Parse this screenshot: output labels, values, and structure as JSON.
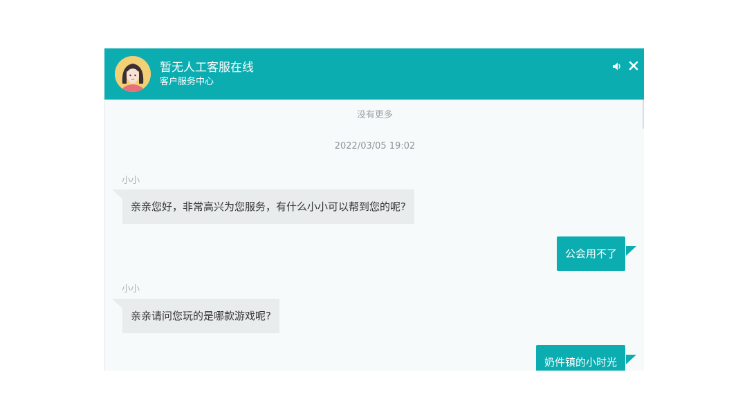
{
  "header": {
    "title": "暂无人工客服在线",
    "subtitle": "客户服务中心",
    "background_color": "#0cadb1",
    "avatar_icon": "girl-avatar-icon",
    "sound_icon": "speaker-icon",
    "close_icon": "close-icon"
  },
  "chat": {
    "load_more_label": "没有更多",
    "timestamp": "2022/03/05 19:02",
    "messages": [
      {
        "direction": "incoming",
        "sender": "小小",
        "text": "亲亲您好，非常高兴为您服务，有什么小小可以帮到您的呢?"
      },
      {
        "direction": "outgoing",
        "text": "公会用不了"
      },
      {
        "direction": "incoming",
        "sender": "小小",
        "text": "亲亲请问您玩的是哪款游戏呢?"
      },
      {
        "direction": "outgoing",
        "text": "奶件镇的小时光"
      }
    ],
    "incoming_bubble_color": "#e9eced",
    "outgoing_bubble_color": "#0cadb1"
  }
}
